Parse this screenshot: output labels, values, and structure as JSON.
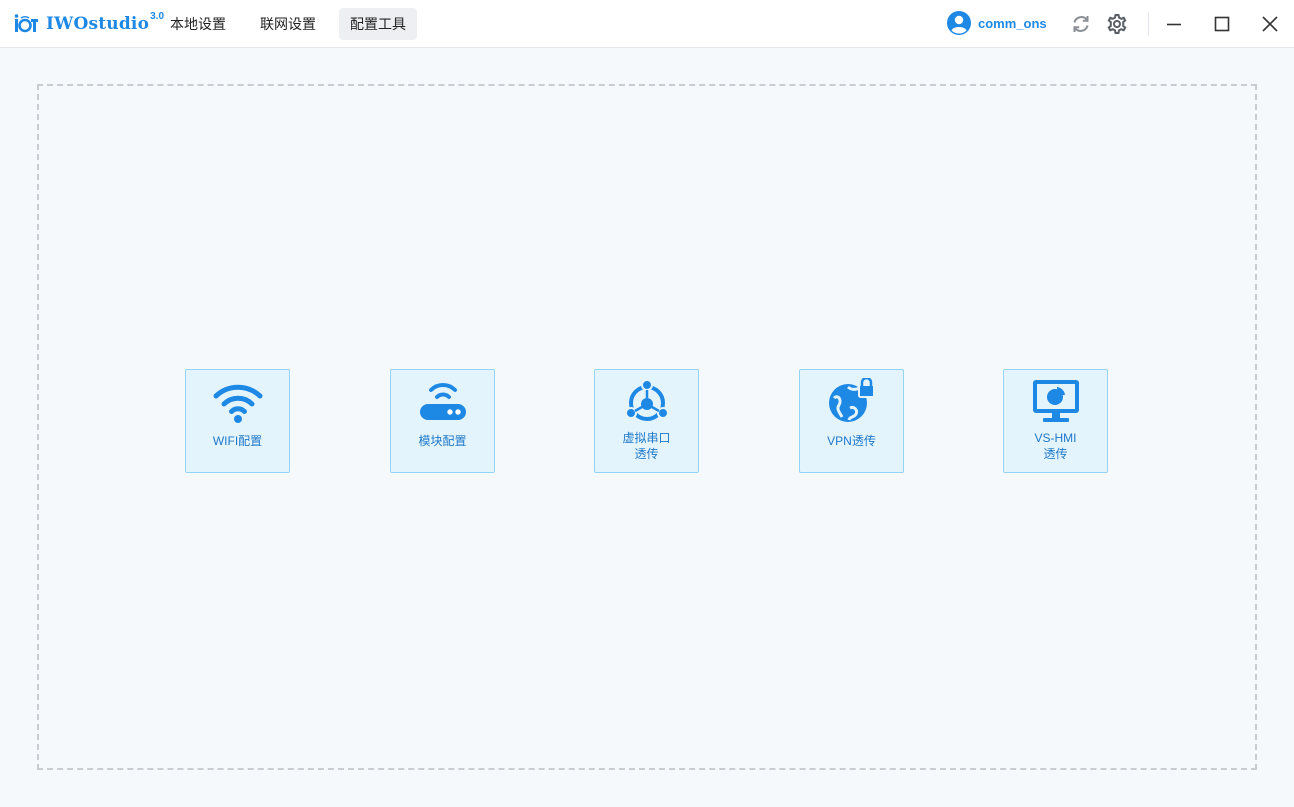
{
  "app": {
    "name": "IWOstudio",
    "version": "3.0"
  },
  "tabs": [
    {
      "label": "本地设置",
      "active": false
    },
    {
      "label": "联网设置",
      "active": false
    },
    {
      "label": "配置工具",
      "active": true
    }
  ],
  "user": {
    "name": "comm_ons",
    "icon": "user-avatar-icon"
  },
  "toolbar_icons": [
    "refresh-icon",
    "settings-gear-icon",
    "minimize-icon",
    "maximize-icon",
    "close-icon"
  ],
  "tools": [
    {
      "label": "WIFI配置",
      "icon": "wifi-icon"
    },
    {
      "label": "模块配置",
      "icon": "router-module-icon"
    },
    {
      "label": "虚拟串口\n透传",
      "icon": "virtual-serial-port-icon"
    },
    {
      "label": "VPN透传",
      "icon": "vpn-globe-lock-icon"
    },
    {
      "label": "VS-HMI\n透传",
      "icon": "monitor-chart-icon"
    }
  ],
  "colors": {
    "accent": "#1e88e5",
    "card_bg": "#e4f4fd",
    "card_border": "#94d4f3",
    "page_bg": "#f5f9fc"
  }
}
